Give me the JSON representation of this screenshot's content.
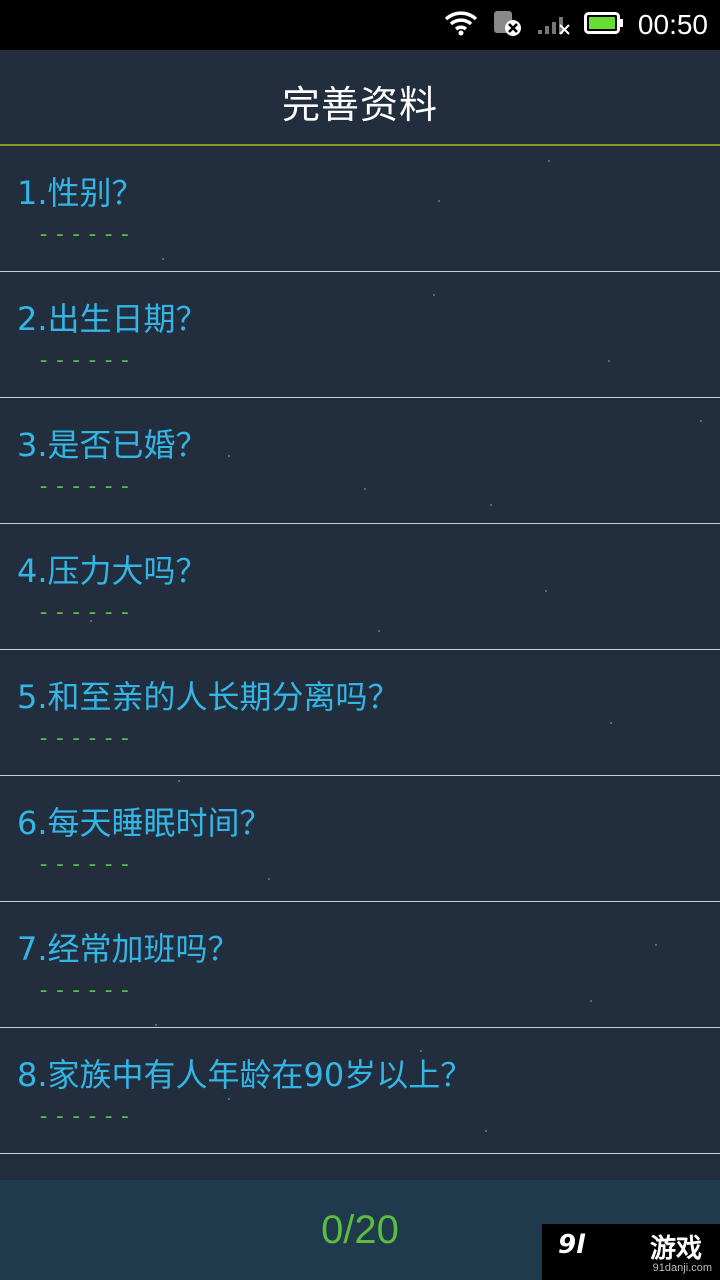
{
  "status_bar": {
    "time": "00:50",
    "icons": [
      "wifi-icon",
      "sim-card-icon",
      "signal-icon",
      "battery-icon"
    ]
  },
  "header": {
    "title": "完善资料"
  },
  "questions": [
    {
      "text": "1.性别？",
      "answer": "------"
    },
    {
      "text": "2.出生日期？",
      "answer": "------"
    },
    {
      "text": "3.是否已婚？",
      "answer": "------"
    },
    {
      "text": "4.压力大吗？",
      "answer": "------"
    },
    {
      "text": "5.和至亲的人长期分离吗？",
      "answer": "------"
    },
    {
      "text": "6.每天睡眠时间？",
      "answer": "------"
    },
    {
      "text": "7.经常加班吗？",
      "answer": "------"
    },
    {
      "text": "8.家族中有人年龄在90岁以上？",
      "answer": "------"
    }
  ],
  "footer": {
    "progress": "0/20"
  },
  "watermark": {
    "logo": "9l",
    "main": "游戏",
    "sub": "91danji.com"
  },
  "colors": {
    "background": "#222e3d",
    "question_text": "#33b5e5",
    "answer_text": "#5cbc40",
    "divider_accent": "#8a9a2a"
  }
}
